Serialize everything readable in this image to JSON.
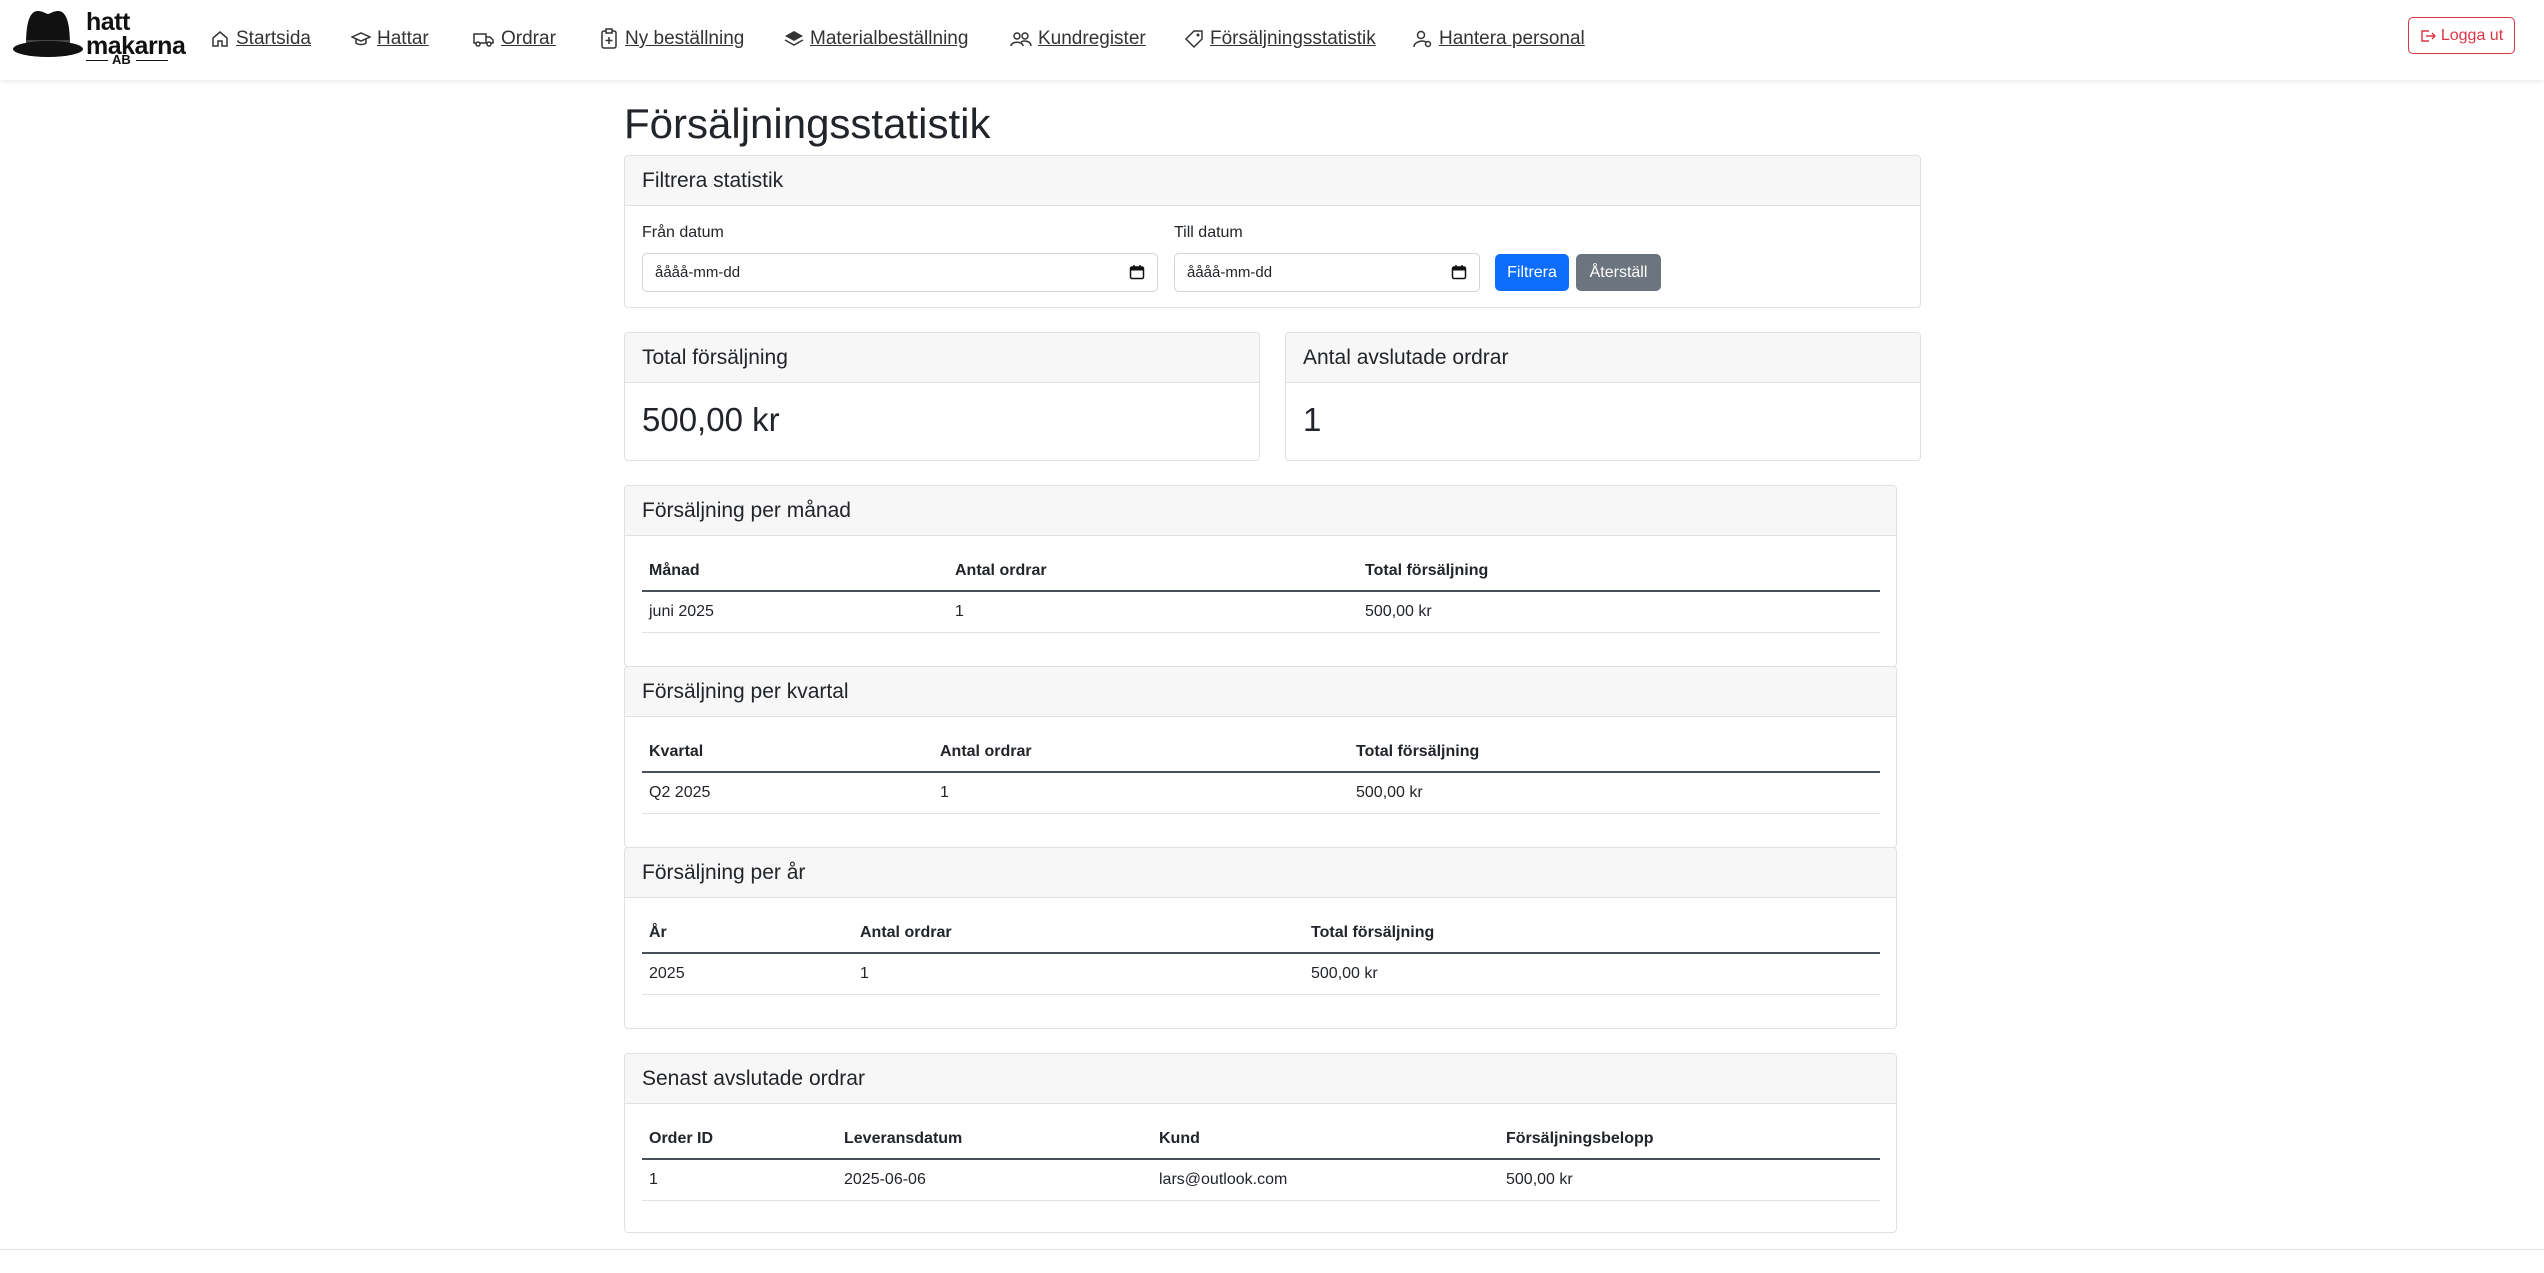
{
  "brand": {
    "line1": "hatt",
    "line2": "makarna",
    "line3": "AB"
  },
  "nav": {
    "items": [
      {
        "label": "Startsida"
      },
      {
        "label": "Hattar"
      },
      {
        "label": "Ordrar"
      },
      {
        "label": "Ny beställning"
      },
      {
        "label": "Materialbeställning"
      },
      {
        "label": "Kundregister"
      },
      {
        "label": "Försäljningsstatistik"
      },
      {
        "label": "Hantera personal"
      }
    ],
    "logout_label": "Logga ut"
  },
  "page": {
    "title": "Försäljningsstatistik"
  },
  "filter": {
    "title": "Filtrera statistik",
    "from_label": "Från datum",
    "from_placeholder": "åååå-mm-dd",
    "to_label": "Till datum",
    "to_placeholder": "åååå-mm-dd",
    "filter_button": "Filtrera",
    "reset_button": "Återställ"
  },
  "summary": {
    "total_sales_title": "Total försäljning",
    "total_sales_value": "500,00 kr",
    "orders_title": "Antal avslutade ordrar",
    "orders_value": "1"
  },
  "monthly": {
    "title": "Försäljning per månad",
    "headers": [
      "Månad",
      "Antal ordrar",
      "Total försäljning"
    ],
    "rows": [
      [
        "juni 2025",
        "1",
        "500,00 kr"
      ]
    ]
  },
  "quarterly": {
    "title": "Försäljning per kvartal",
    "headers": [
      "Kvartal",
      "Antal ordrar",
      "Total försäljning"
    ],
    "rows": [
      [
        "Q2 2025",
        "1",
        "500,00 kr"
      ]
    ]
  },
  "yearly": {
    "title": "Försäljning per år",
    "headers": [
      "År",
      "Antal ordrar",
      "Total försäljning"
    ],
    "rows": [
      [
        "2025",
        "1",
        "500,00 kr"
      ]
    ]
  },
  "recent": {
    "title": "Senast avslutade ordrar",
    "headers": [
      "Order ID",
      "Leveransdatum",
      "Kund",
      "Försäljningsbelopp"
    ],
    "rows": [
      [
        "1",
        "2025-06-06",
        "lars@outlook.com",
        "500,00 kr"
      ]
    ]
  },
  "colors": {
    "primary": "#0d6efd",
    "secondary": "#6c757d",
    "danger": "#dc3545"
  }
}
